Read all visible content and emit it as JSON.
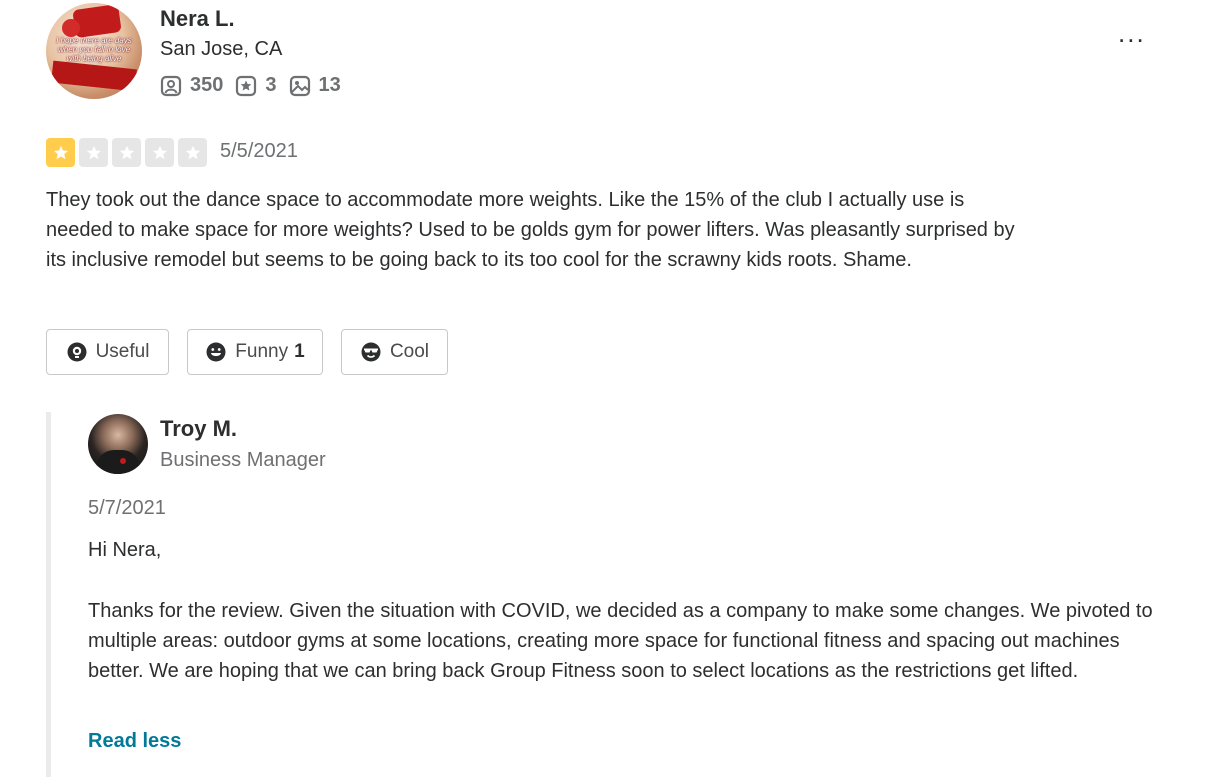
{
  "reviewer": {
    "name": "Nera L.",
    "location": "San Jose, CA",
    "avatar_text": "I hope there are days when you fall in love with being alive",
    "stats": {
      "friends": "350",
      "reviews": "3",
      "photos": "13"
    }
  },
  "more_label": "...",
  "review": {
    "rating": 1,
    "max_rating": 5,
    "date": "5/5/2021",
    "text": "They took out the dance space to accommodate more weights. Like the  15% of the club I actually use is needed to make space for more weights?  Used to be golds gym for power lifters. Was pleasantly surprised by its inclusive remodel but seems to be going back to its too cool for the scrawny kids roots. Shame."
  },
  "reactions": {
    "useful": {
      "label": "Useful",
      "count": ""
    },
    "funny": {
      "label": "Funny",
      "count": "1"
    },
    "cool": {
      "label": "Cool",
      "count": ""
    }
  },
  "owner_reply": {
    "name": "Troy M.",
    "role": "Business Manager",
    "date": "5/7/2021",
    "greeting": "Hi Nera,",
    "text": "Thanks for the review. Given the situation with COVID, we decided as a company to make some changes. We pivoted to multiple areas: outdoor gyms at some locations, creating more space for functional fitness and spacing out machines better. We are hoping that we can bring back Group Fitness soon to select locations as the restrictions get lifted.",
    "read_less_label": "Read less"
  },
  "colors": {
    "star_on": "#ffcc4b",
    "star_off": "#e6e6e6",
    "link": "#027a97"
  }
}
